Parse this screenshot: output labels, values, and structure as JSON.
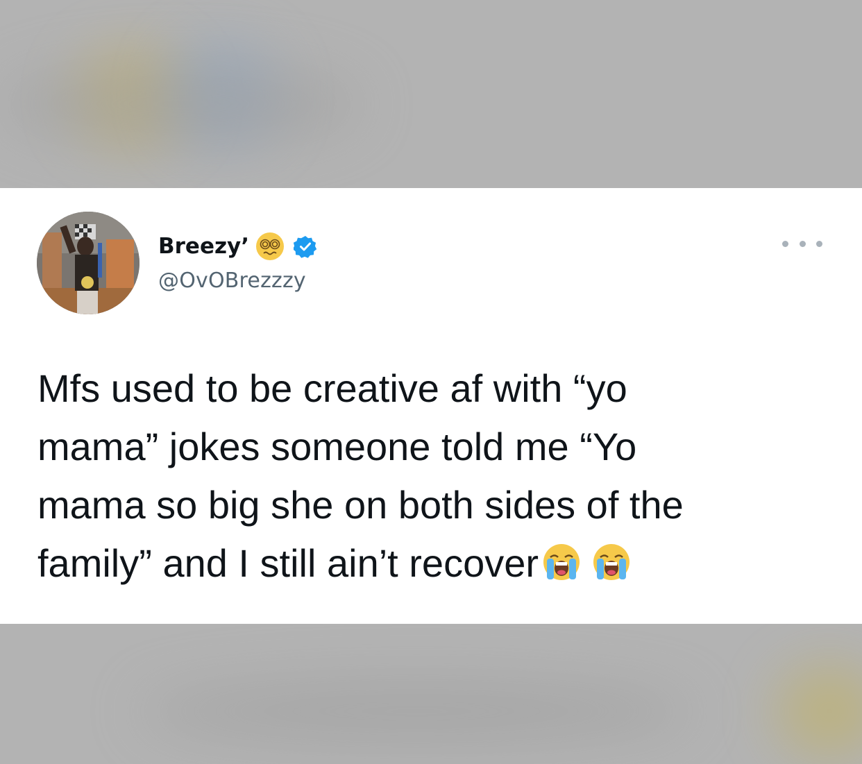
{
  "tweet": {
    "display_name": "Breezy’",
    "handle": "@OvOBrezzzy",
    "text": "Mfs used to be creative af with “yo\nmama” jokes someone told me “Yo\nmama so big she on both sides of the\nfamily” and I still ain’t recover",
    "name_emoji": "dizzy-face-emoji",
    "trailing_emojis": [
      "loudly-crying-face-emoji",
      "loudly-crying-face-emoji"
    ],
    "verified": true
  },
  "colors": {
    "background": "#b3b3b3",
    "card": "#ffffff",
    "text": "#0f1419",
    "secondary": "#536471",
    "verified": "#1d9bf0"
  }
}
